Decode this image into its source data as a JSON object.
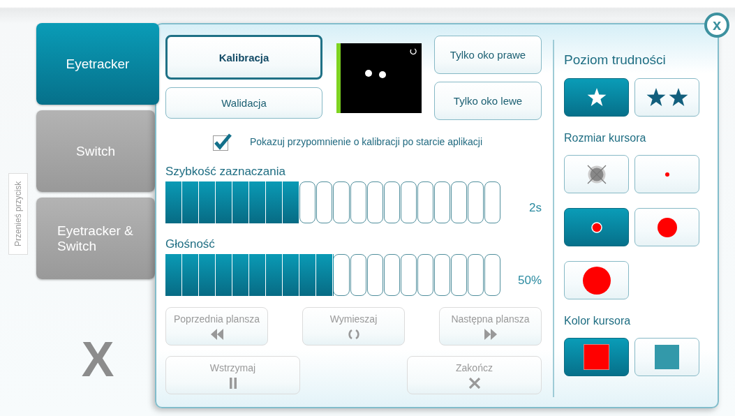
{
  "side_label": "Przenieś przycisk",
  "tabs": [
    {
      "label": "Eyetracker",
      "selected": true
    },
    {
      "label": "Switch",
      "selected": false
    },
    {
      "label": "Eyetracker & Switch",
      "selected": false
    }
  ],
  "exit_label": "X",
  "close_button": "x",
  "calibration_buttons": [
    {
      "label": "Kalibracja",
      "kind": "primary"
    },
    {
      "label": "Walidacja",
      "kind": "normal"
    }
  ],
  "eye_buttons": [
    "Tylko oko prawe",
    "Tylko oko lewe"
  ],
  "reminder": {
    "label": "Pokazuj przypomnienie o kalibracji po starcie aplikacji",
    "checked": true
  },
  "sliders": [
    {
      "label": "Szybkość zaznaczania",
      "level": 0.4,
      "reading": "2s"
    },
    {
      "label": "Głośność",
      "level": 0.5,
      "reading": "50%"
    }
  ],
  "nav_buttons": [
    {
      "label": "Poprzednia plansza",
      "kind": "previous",
      "disabled": true
    },
    {
      "label": "Wymieszaj",
      "kind": "shuffle",
      "disabled": true
    },
    {
      "label": "Następna plansza",
      "kind": "next",
      "disabled": true
    }
  ],
  "bottom_buttons": [
    {
      "label": "Wstrzymaj",
      "kind": "pause",
      "disabled": true
    },
    {
      "label": "Zakończ",
      "kind": "end",
      "disabled": true
    }
  ],
  "difficulty": {
    "title": "Poziom trudności",
    "options": [
      {
        "kind": "one_star",
        "selected": true
      },
      {
        "kind": "two_stars",
        "selected": false
      }
    ]
  },
  "cursor_size": {
    "title": "Rozmiar kursora",
    "options": [
      {
        "kind": "none",
        "selected": false
      },
      {
        "kind": "tiny",
        "selected": false
      },
      {
        "kind": "small",
        "selected": true
      },
      {
        "kind": "medium",
        "selected": false
      },
      {
        "kind": "large",
        "selected": false
      }
    ]
  },
  "cursor_color": {
    "title": "Kolor kursora",
    "options": [
      {
        "color": "#ff0000",
        "selected": true
      },
      {
        "color": "#3399aa",
        "selected": false
      }
    ]
  }
}
